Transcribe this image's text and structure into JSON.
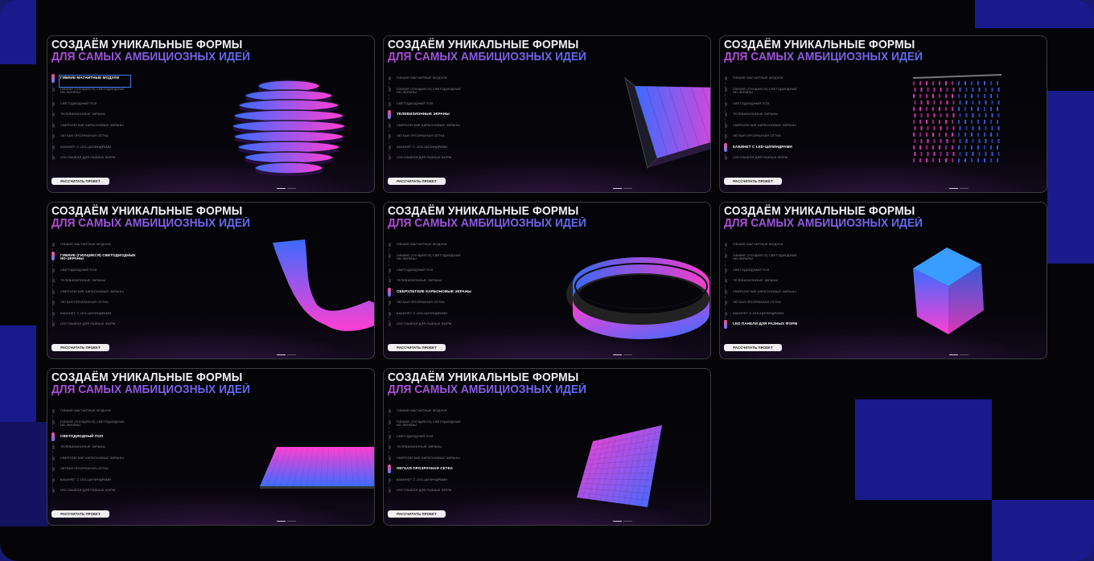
{
  "slide": {
    "title_line1": "СОЗДАЁМ УНИКАЛЬНЫЕ ФОРМЫ",
    "title_line2": "ДЛЯ САМЫХ АМБИЦИОЗНЫХ ИДЕЙ",
    "cta_label": "РАССЧИТАТЬ ПРОЕКТ",
    "menu": [
      "ГИБКИЕ МАГНИТНЫЕ МОДУЛИ",
      "ГИБКИЕ (ГНУЩИЕСЯ) СВЕТОДИОДНЫЕ\nHD-ЭКРАНЫ",
      "СВЕТОДИОДНЫЙ ПОЛ",
      "ТЕЛЕВИЗИОННЫЕ ЭКРАНЫ",
      "СВЕРХЛЕГКИЕ КАРБОНОВЫЕ ЭКРАНЫ",
      "ЛЕГКАЯ ПРОЗРАЧНАЯ СЕТКА",
      "КАБИНЕТ С LED-ЦИЛИНДРАМИ",
      "LED ПАНЕЛИ ДЛЯ РАЗНЫХ ФОРМ"
    ]
  },
  "cards": [
    {
      "active": 0,
      "shape": "sphere-icon"
    },
    {
      "active": 3,
      "shape": "bent-screen-icon"
    },
    {
      "active": 6,
      "shape": "led-cylinders-icon"
    },
    {
      "active": 1,
      "shape": "flexible-wave-icon"
    },
    {
      "active": 4,
      "shape": "ring-screen-icon"
    },
    {
      "active": 7,
      "shape": "cube-icon"
    },
    {
      "active": 2,
      "shape": "led-floor-icon"
    },
    {
      "active": 5,
      "shape": "mesh-panel-icon"
    }
  ],
  "colors": {
    "pink": "#ff3fd2",
    "blue": "#3b6cff",
    "violet": "#8a3bd8",
    "frame_blue": "#1a1a8c"
  }
}
